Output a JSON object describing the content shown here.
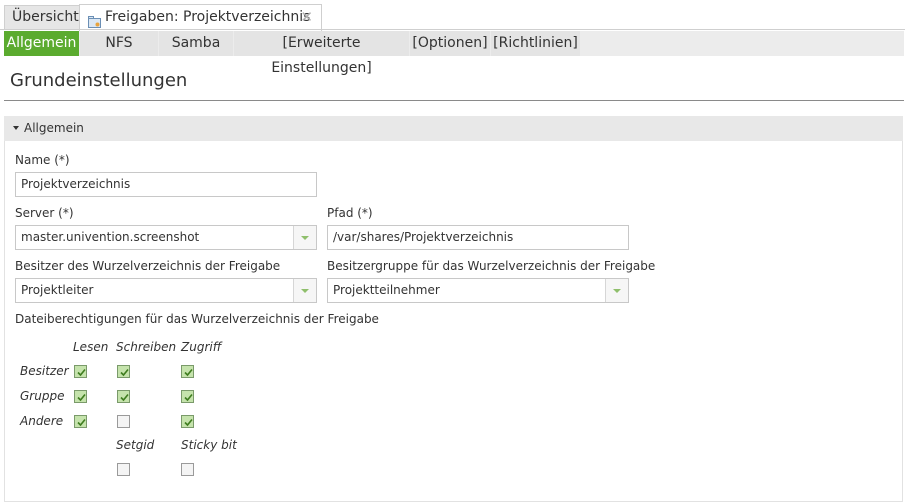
{
  "tabs": {
    "overview": "Übersicht",
    "module": "Freigaben: Projektverzeichnis",
    "close": "✕"
  },
  "subtabs": [
    "Allgemein",
    "NFS",
    "Samba",
    "[Erweiterte Einstellungen]",
    "[Optionen]",
    "[Richtlinien]"
  ],
  "active_subtab": "Allgemein",
  "heading": "Grundeinstellungen",
  "section": {
    "title": "Allgemein",
    "name_label": "Name (*)",
    "name_value": "Projektverzeichnis",
    "server_label": "Server (*)",
    "server_value": "master.univention.screenshot",
    "path_label": "Pfad (*)",
    "path_value": "/var/shares/Projektverzeichnis",
    "owner_label": "Besitzer des Wurzelverzeichnis der Freigabe",
    "owner_value": "Projektleiter",
    "group_label": "Besitzergruppe für das Wurzelverzeichnis der Freigabe",
    "group_value": "Projektteilnehmer",
    "perm_label": "Dateiberechtigungen für das Wurzelverzeichnis der Freigabe"
  },
  "permissions": {
    "columns": [
      "Lesen",
      "Schreiben",
      "Zugriff"
    ],
    "rows": [
      {
        "label": "Besitzer",
        "values": [
          true,
          true,
          true
        ]
      },
      {
        "label": "Gruppe",
        "values": [
          true,
          true,
          true
        ]
      },
      {
        "label": "Andere",
        "values": [
          true,
          false,
          true
        ]
      }
    ],
    "extra": [
      {
        "label": "Setgid",
        "checked": false
      },
      {
        "label": "Sticky bit",
        "checked": false
      }
    ]
  },
  "colors": {
    "accent": "#5bab2f",
    "checkbox_on": "#c5e3ac"
  }
}
